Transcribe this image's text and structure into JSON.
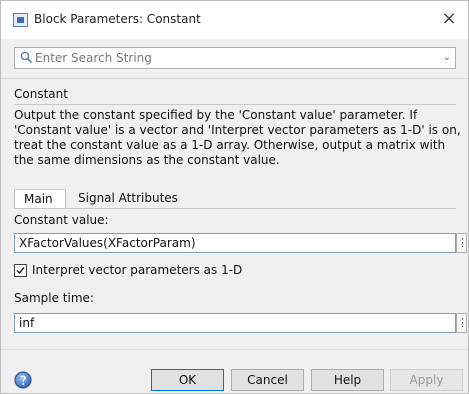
{
  "window": {
    "title": "Block Parameters: Constant",
    "close_glyph": "×"
  },
  "search": {
    "placeholder": "Enter Search String",
    "dropdown_glyph": "⌄"
  },
  "block": {
    "name": "Constant",
    "description": "Output the constant specified by the 'Constant value' parameter. If\n'Constant value' is a vector and 'Interpret vector parameters as 1-D' is on,\ntreat the constant value as a 1-D array. Otherwise, output a matrix with\nthe same dimensions as the constant value."
  },
  "tabs": [
    {
      "label": "Main",
      "active": true
    },
    {
      "label": "Signal Attributes",
      "active": false
    }
  ],
  "main": {
    "constant_value_label": "Constant value:",
    "constant_value": "XFactorValues(XFactorParam)",
    "interpret_vector_label": "Interpret vector parameters as 1-D",
    "interpret_vector_checked": true,
    "sample_time_label": "Sample time:",
    "sample_time": "inf",
    "more_glyph": "⋮"
  },
  "buttons": {
    "ok": "OK",
    "cancel": "Cancel",
    "help": "Help",
    "apply": "Apply",
    "apply_enabled": false
  },
  "icons": {
    "app": "simulink-block-icon",
    "search": "magnifier-icon",
    "help": "help-circle-icon"
  },
  "colors": {
    "accent": "#0078d7",
    "help_icon": "#3a6fc4"
  }
}
